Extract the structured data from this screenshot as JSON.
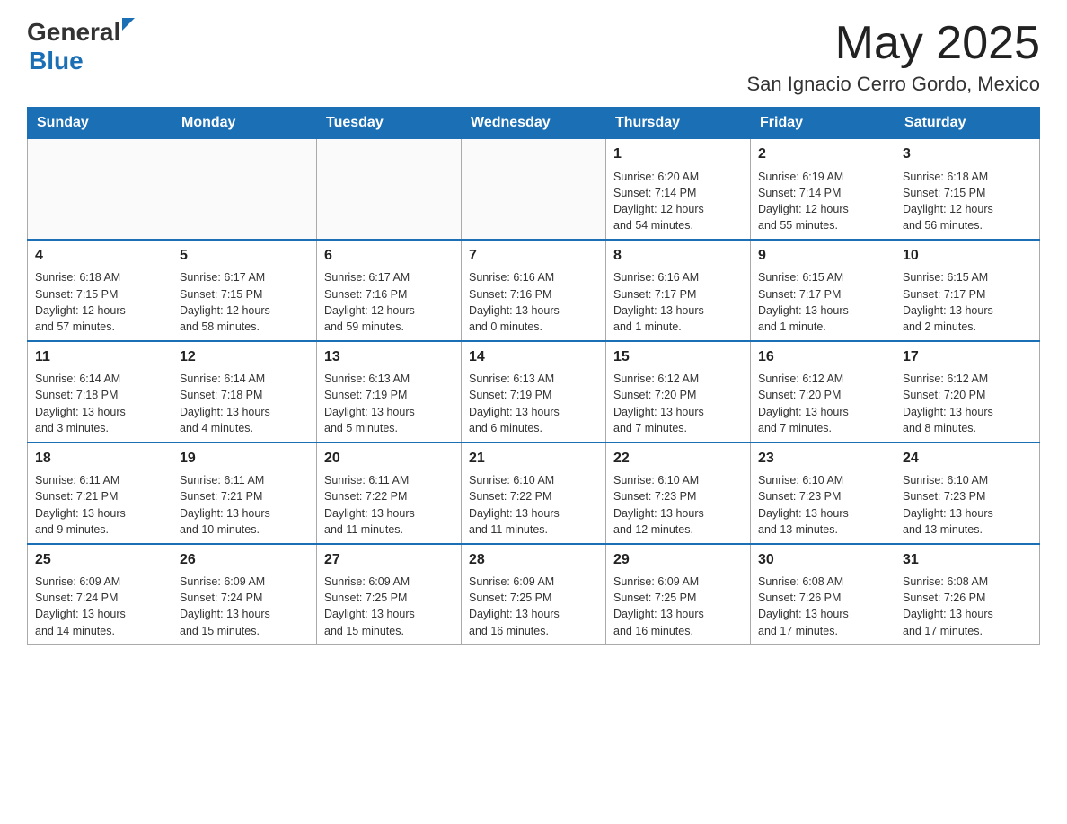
{
  "header": {
    "logo": {
      "general": "General",
      "blue": "Blue",
      "arrow": "▶"
    },
    "month_year": "May 2025",
    "location": "San Ignacio Cerro Gordo, Mexico"
  },
  "weekdays": [
    "Sunday",
    "Monday",
    "Tuesday",
    "Wednesday",
    "Thursday",
    "Friday",
    "Saturday"
  ],
  "weeks": [
    [
      {
        "day": "",
        "info": ""
      },
      {
        "day": "",
        "info": ""
      },
      {
        "day": "",
        "info": ""
      },
      {
        "day": "",
        "info": ""
      },
      {
        "day": "1",
        "info": "Sunrise: 6:20 AM\nSunset: 7:14 PM\nDaylight: 12 hours\nand 54 minutes."
      },
      {
        "day": "2",
        "info": "Sunrise: 6:19 AM\nSunset: 7:14 PM\nDaylight: 12 hours\nand 55 minutes."
      },
      {
        "day": "3",
        "info": "Sunrise: 6:18 AM\nSunset: 7:15 PM\nDaylight: 12 hours\nand 56 minutes."
      }
    ],
    [
      {
        "day": "4",
        "info": "Sunrise: 6:18 AM\nSunset: 7:15 PM\nDaylight: 12 hours\nand 57 minutes."
      },
      {
        "day": "5",
        "info": "Sunrise: 6:17 AM\nSunset: 7:15 PM\nDaylight: 12 hours\nand 58 minutes."
      },
      {
        "day": "6",
        "info": "Sunrise: 6:17 AM\nSunset: 7:16 PM\nDaylight: 12 hours\nand 59 minutes."
      },
      {
        "day": "7",
        "info": "Sunrise: 6:16 AM\nSunset: 7:16 PM\nDaylight: 13 hours\nand 0 minutes."
      },
      {
        "day": "8",
        "info": "Sunrise: 6:16 AM\nSunset: 7:17 PM\nDaylight: 13 hours\nand 1 minute."
      },
      {
        "day": "9",
        "info": "Sunrise: 6:15 AM\nSunset: 7:17 PM\nDaylight: 13 hours\nand 1 minute."
      },
      {
        "day": "10",
        "info": "Sunrise: 6:15 AM\nSunset: 7:17 PM\nDaylight: 13 hours\nand 2 minutes."
      }
    ],
    [
      {
        "day": "11",
        "info": "Sunrise: 6:14 AM\nSunset: 7:18 PM\nDaylight: 13 hours\nand 3 minutes."
      },
      {
        "day": "12",
        "info": "Sunrise: 6:14 AM\nSunset: 7:18 PM\nDaylight: 13 hours\nand 4 minutes."
      },
      {
        "day": "13",
        "info": "Sunrise: 6:13 AM\nSunset: 7:19 PM\nDaylight: 13 hours\nand 5 minutes."
      },
      {
        "day": "14",
        "info": "Sunrise: 6:13 AM\nSunset: 7:19 PM\nDaylight: 13 hours\nand 6 minutes."
      },
      {
        "day": "15",
        "info": "Sunrise: 6:12 AM\nSunset: 7:20 PM\nDaylight: 13 hours\nand 7 minutes."
      },
      {
        "day": "16",
        "info": "Sunrise: 6:12 AM\nSunset: 7:20 PM\nDaylight: 13 hours\nand 7 minutes."
      },
      {
        "day": "17",
        "info": "Sunrise: 6:12 AM\nSunset: 7:20 PM\nDaylight: 13 hours\nand 8 minutes."
      }
    ],
    [
      {
        "day": "18",
        "info": "Sunrise: 6:11 AM\nSunset: 7:21 PM\nDaylight: 13 hours\nand 9 minutes."
      },
      {
        "day": "19",
        "info": "Sunrise: 6:11 AM\nSunset: 7:21 PM\nDaylight: 13 hours\nand 10 minutes."
      },
      {
        "day": "20",
        "info": "Sunrise: 6:11 AM\nSunset: 7:22 PM\nDaylight: 13 hours\nand 11 minutes."
      },
      {
        "day": "21",
        "info": "Sunrise: 6:10 AM\nSunset: 7:22 PM\nDaylight: 13 hours\nand 11 minutes."
      },
      {
        "day": "22",
        "info": "Sunrise: 6:10 AM\nSunset: 7:23 PM\nDaylight: 13 hours\nand 12 minutes."
      },
      {
        "day": "23",
        "info": "Sunrise: 6:10 AM\nSunset: 7:23 PM\nDaylight: 13 hours\nand 13 minutes."
      },
      {
        "day": "24",
        "info": "Sunrise: 6:10 AM\nSunset: 7:23 PM\nDaylight: 13 hours\nand 13 minutes."
      }
    ],
    [
      {
        "day": "25",
        "info": "Sunrise: 6:09 AM\nSunset: 7:24 PM\nDaylight: 13 hours\nand 14 minutes."
      },
      {
        "day": "26",
        "info": "Sunrise: 6:09 AM\nSunset: 7:24 PM\nDaylight: 13 hours\nand 15 minutes."
      },
      {
        "day": "27",
        "info": "Sunrise: 6:09 AM\nSunset: 7:25 PM\nDaylight: 13 hours\nand 15 minutes."
      },
      {
        "day": "28",
        "info": "Sunrise: 6:09 AM\nSunset: 7:25 PM\nDaylight: 13 hours\nand 16 minutes."
      },
      {
        "day": "29",
        "info": "Sunrise: 6:09 AM\nSunset: 7:25 PM\nDaylight: 13 hours\nand 16 minutes."
      },
      {
        "day": "30",
        "info": "Sunrise: 6:08 AM\nSunset: 7:26 PM\nDaylight: 13 hours\nand 17 minutes."
      },
      {
        "day": "31",
        "info": "Sunrise: 6:08 AM\nSunset: 7:26 PM\nDaylight: 13 hours\nand 17 minutes."
      }
    ]
  ]
}
